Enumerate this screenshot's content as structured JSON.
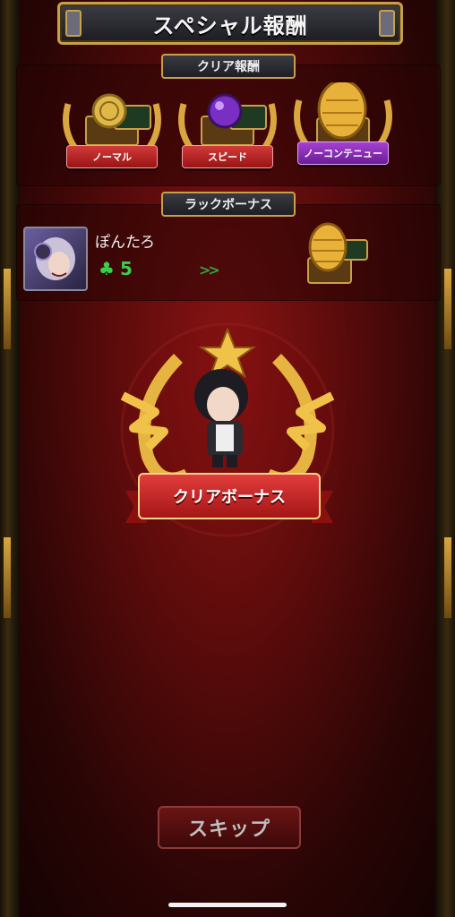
{
  "header": {
    "title": "スペシャル報酬"
  },
  "clear_rewards": {
    "label": "クリア報酬",
    "items": [
      {
        "label": "ノーマル",
        "color": "#c62828",
        "icon": "gold-coin-chest-icon"
      },
      {
        "label": "スピード",
        "color": "#c62828",
        "icon": "purple-orb-chest-icon"
      },
      {
        "label": "ノーコンテニュー",
        "color": "#8e24aa",
        "icon": "golden-egg-chest-icon"
      }
    ]
  },
  "luck_bonus": {
    "label": "ラックボーナス",
    "player_name": "ぽんたろ",
    "luck_value": "5",
    "arrows": ">>",
    "reward_icon": "golden-egg-chest-icon"
  },
  "clear_bonus": {
    "label": "クリアボーナス",
    "icon": "character-laurel-emblem-icon"
  },
  "skip_button": {
    "label": "スキップ"
  }
}
